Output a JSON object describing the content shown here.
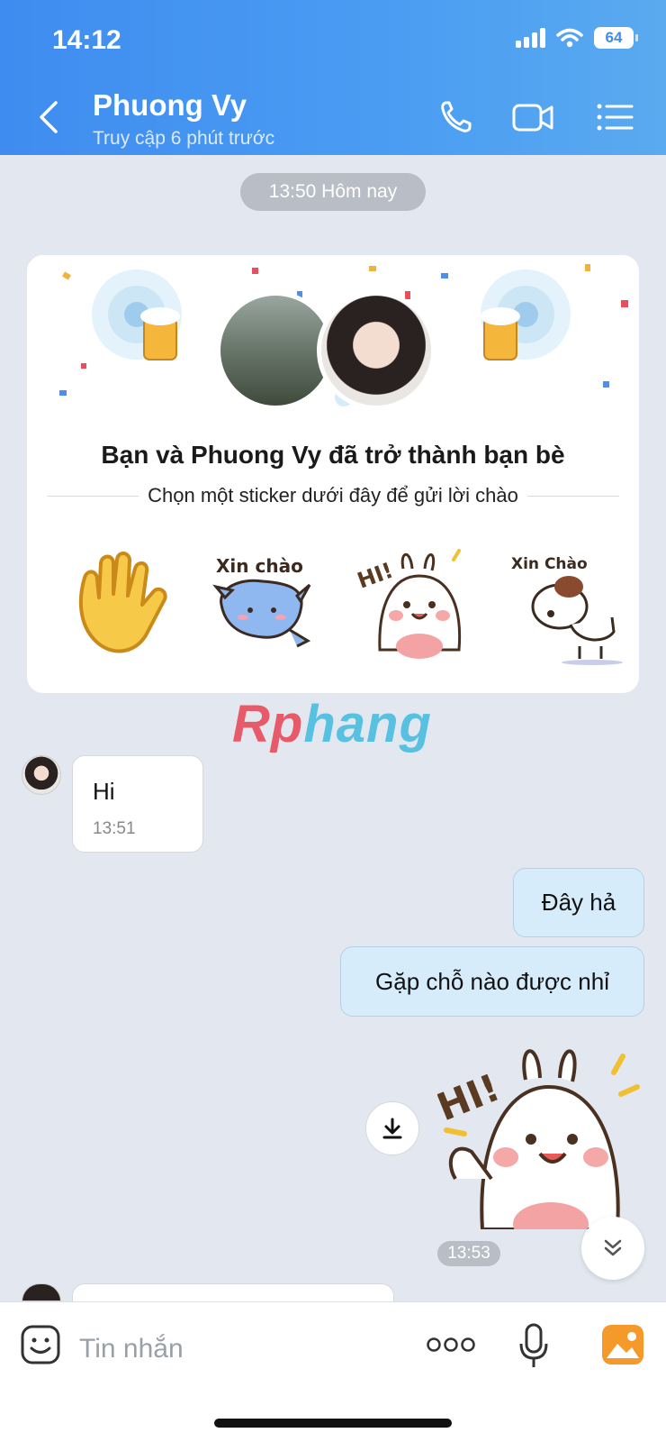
{
  "status_bar": {
    "time": "14:12",
    "battery": "64"
  },
  "header": {
    "contact_name": "Phuong Vy",
    "last_seen": "Truy cập 6 phút trước"
  },
  "date_divider": "13:50 Hôm nay",
  "friend_card": {
    "title": "Bạn và Phuong Vy đã trở thành bạn bè",
    "subtitle": "Chọn một sticker dưới đây để gửi lời chào",
    "stickers": [
      "waving-hand",
      "Xin chào",
      "HI!",
      "Xin Chào"
    ]
  },
  "watermark": {
    "part1": "Rp",
    "part2": "hang"
  },
  "messages": [
    {
      "direction": "in",
      "text": "Hi",
      "time": "13:51"
    },
    {
      "direction": "out",
      "text": "Đây hả"
    },
    {
      "direction": "out",
      "text": "Gặp chỗ nào được nhỉ"
    },
    {
      "direction": "out",
      "sticker_text": "HI!",
      "time": "13:53"
    }
  ],
  "input": {
    "placeholder": "Tin nhắn"
  },
  "icons": [
    "back-icon",
    "phone-icon",
    "video-icon",
    "menu-icon",
    "download-icon",
    "scroll-down-icon",
    "emoji-icon",
    "more-icon",
    "microphone-icon",
    "image-icon"
  ],
  "colors": {
    "header": "#3f8cf0",
    "outgoing_bubble": "#d6ecfb",
    "background": "#e3e8f0"
  }
}
